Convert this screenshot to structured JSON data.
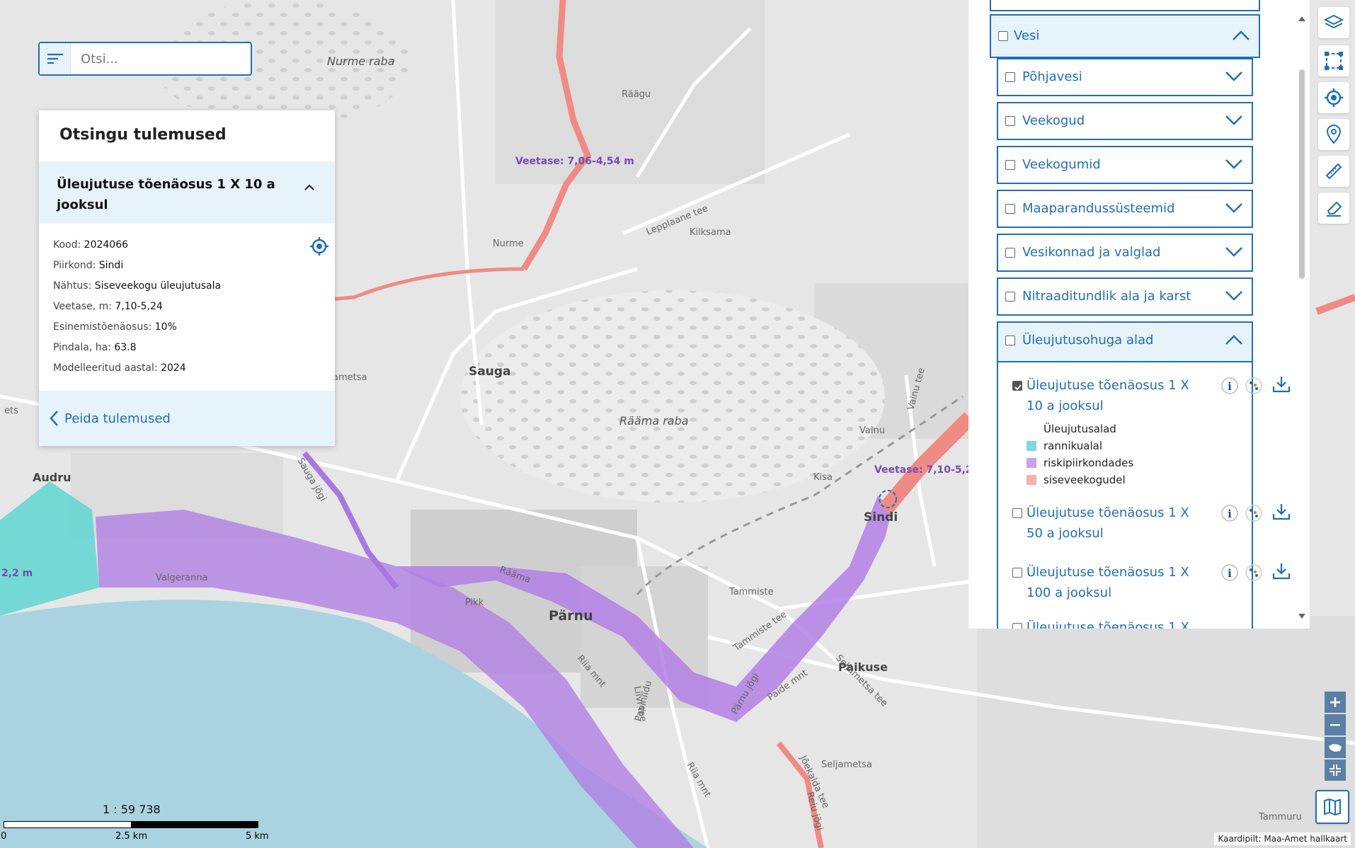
{
  "search": {
    "placeholder": "Otsi..."
  },
  "results": {
    "title": "Otsingu tulemused",
    "item_title": "Üleujutuse tõenäosus 1 X 10 a jooksul",
    "attributes": [
      {
        "key": "Kood:",
        "value": "2024066"
      },
      {
        "key": "Piirkond:",
        "value": "Sindi"
      },
      {
        "key": "Nähtus:",
        "value": "Siseveekogu üleujutusala"
      },
      {
        "key": "Veetase, m:",
        "value": "7,10-5,24"
      },
      {
        "key": "Esinemistõenäosus:",
        "value": "10%"
      },
      {
        "key": "Pindala, ha:",
        "value": "63.8"
      },
      {
        "key": "Modelleeritud aastal:",
        "value": "2024"
      }
    ],
    "hide_label": "Peida tulemused"
  },
  "layers": {
    "groups": [
      {
        "name": "Vesi",
        "open": true
      },
      {
        "name": "Põhjavesi",
        "open": false
      },
      {
        "name": "Veekogud",
        "open": false
      },
      {
        "name": "Veekogumid",
        "open": false
      },
      {
        "name": "Maaparandussüsteemid",
        "open": false
      },
      {
        "name": "Vesikonnad ja valglad",
        "open": false
      },
      {
        "name": "Nitraaditundlik ala ja karst",
        "open": false
      },
      {
        "name": "Üleujutusohuga alad",
        "open": true
      }
    ],
    "flood_layers": [
      {
        "name": "Üleujutuse tõenäosus 1 X 10 a jooksul",
        "checked": true
      },
      {
        "name": "Üleujutuse tõenäosus 1 X 50 a jooksul",
        "checked": false
      },
      {
        "name": "Üleujutuse tõenäosus 1 X 100 a jooksul",
        "checked": false
      },
      {
        "name": "Üleujutuse tõenäosus 1 X",
        "checked": false
      }
    ],
    "legend": {
      "title": "Üleujutusalad",
      "items": [
        {
          "label": "rannikualal",
          "color": "#7fd9d9"
        },
        {
          "label": "riskipiirkondades",
          "color": "#c9a3ea"
        },
        {
          "label": "siseveekogudel",
          "color": "#f6b0ac"
        }
      ]
    }
  },
  "map": {
    "places": [
      "Nurme raba",
      "Lepplaane",
      "Räägu",
      "Nurme",
      "Kilksama",
      "Sauga",
      "Rääma raba",
      "Vainu",
      "Kisa",
      "Sindi",
      "Audru",
      "Valgeranna",
      "Pärnu",
      "Pikk",
      "Tammiste",
      "Paikuse",
      "Seljametsa",
      "Tammuru",
      "ametsa",
      "ets"
    ],
    "roads": [
      "Lepplaane tee",
      "Vainu tee",
      "Tammiste tee",
      "Riia mnt",
      "Papiniidu",
      "Liivi tee",
      "Paide mnt",
      "Seljametsa tee",
      "Jõekalda tee",
      "Reiu jõgi",
      "Pärnu jõgi",
      "Sauga jõgi",
      "Rääma"
    ],
    "water_labels": [
      "Veetase: 7,06-4,54 m",
      "Veetase: 7,10-5,2",
      "2,2 m"
    ],
    "colors": {
      "coastal": "#5fd6d0",
      "risk": "#b27fe4",
      "inland": "#ef8a84",
      "sea": "#a9d3e0"
    }
  },
  "scale": {
    "ratio": "1 : 59 738",
    "ticks": [
      "0",
      "2.5 km",
      "5 km"
    ]
  },
  "attribution": "Kaardipilt: Maa-Amet hallkaart"
}
